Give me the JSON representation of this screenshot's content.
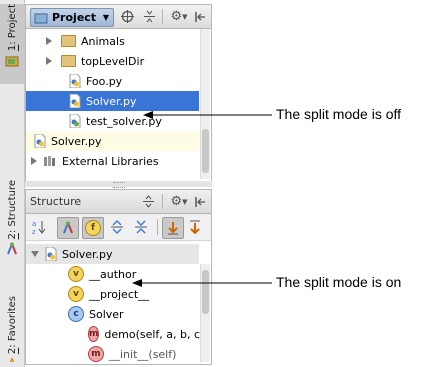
{
  "sidebar": {
    "tabs": [
      {
        "number": "1",
        "label": ": Project"
      },
      {
        "number": "2",
        "label": ": Structure"
      },
      {
        "number": "2",
        "label": ": Favorites"
      }
    ]
  },
  "project_panel": {
    "title": "Project",
    "tree": [
      {
        "label": "Animals",
        "kind": "folder",
        "expander": "collapsed"
      },
      {
        "label": "topLevelDir",
        "kind": "folder",
        "expander": "collapsed"
      },
      {
        "label": "Foo.py",
        "kind": "python-file"
      },
      {
        "label": "Solver.py",
        "kind": "python-file",
        "selected": true
      },
      {
        "label": "test_solver.py",
        "kind": "python-file"
      },
      {
        "label": "Solver.py",
        "kind": "python-file",
        "highlighted": true
      },
      {
        "label": "External Libraries",
        "kind": "library",
        "expander": "collapsed"
      }
    ]
  },
  "structure_panel": {
    "title": "Structure",
    "tree": [
      {
        "label": "Solver.py",
        "kind": "python-file",
        "expander": "expanded",
        "highlighted": true
      },
      {
        "label": "__author",
        "kind": "variable",
        "badge": "v"
      },
      {
        "label": "__project__",
        "kind": "variable",
        "badge": "v"
      },
      {
        "label": "Solver",
        "kind": "class",
        "badge": "c"
      },
      {
        "label": "demo(self, a, b, c)",
        "kind": "method",
        "badge": "m"
      },
      {
        "label": "__init__(self)",
        "kind": "method",
        "badge": "m"
      }
    ]
  },
  "callouts": {
    "off": "The split mode is off",
    "on": "The split mode is on"
  },
  "colors": {
    "selection": "#3875d7",
    "highlight_row": "#fefce4",
    "variable_badge": "#f4d35e",
    "class_badge": "#a9c9f5",
    "method_badge": "#f1a5a5"
  }
}
